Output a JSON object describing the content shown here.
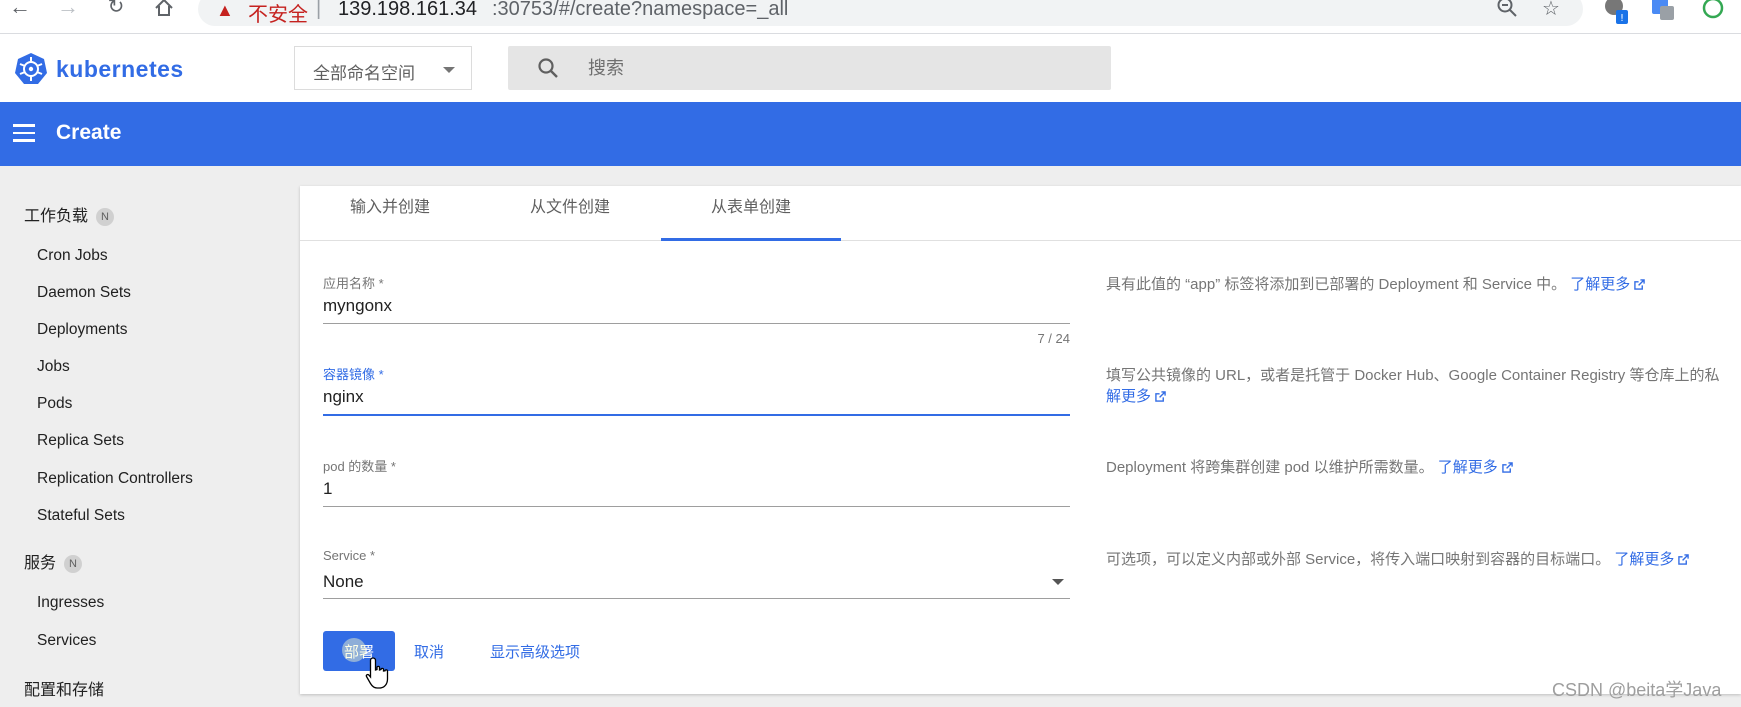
{
  "browser": {
    "insecure_label": "不安全",
    "separator": "|",
    "url_host": "139.198.161.34",
    "url_rest": ":30753/#/create?namespace=_all"
  },
  "app": {
    "brand": "kubernetes",
    "namespace_select": "全部命名空间",
    "search_placeholder": "搜索",
    "page_title": "Create",
    "brand_color": "#326ce5"
  },
  "sidebar": {
    "workloads": {
      "label": "工作负载",
      "badge": "N"
    },
    "workload_items": [
      "Cron Jobs",
      "Daemon Sets",
      "Deployments",
      "Jobs",
      "Pods",
      "Replica Sets",
      "Replication Controllers",
      "Stateful Sets"
    ],
    "services": {
      "label": "服务",
      "badge": "N"
    },
    "service_items": [
      "Ingresses",
      "Services"
    ],
    "config": {
      "label": "配置和存储"
    }
  },
  "tabs": [
    "输入并创建",
    "从文件创建",
    "从表单创建"
  ],
  "form": {
    "app_name": {
      "label": "应用名称 *",
      "value": "myngonx",
      "counter": "7 / 24"
    },
    "image": {
      "label": "容器镜像 *",
      "value": "nginx"
    },
    "pods": {
      "label": "pod 的数量 *",
      "value": "1"
    },
    "service": {
      "label": "Service *",
      "value": "None"
    }
  },
  "help": {
    "app_name": "具有此值的 “app” 标签将添加到已部署的 Deployment 和 Service 中。",
    "image_line1": "填写公共镜像的 URL，或者是托管于 Docker Hub、Google Container Registry 等仓库上的私",
    "image_line2_link": "解更多",
    "pods": "Deployment 将跨集群创建 pod 以维护所需数量。",
    "service": "可选项，可以定义内部或外部 Service，将传入端口映射到容器的目标端口。",
    "learn_more": "了解更多"
  },
  "actions": {
    "deploy": "部署",
    "cancel": "取消",
    "advanced": "显示高级选项"
  },
  "watermark": "CSDN @beita学Java"
}
